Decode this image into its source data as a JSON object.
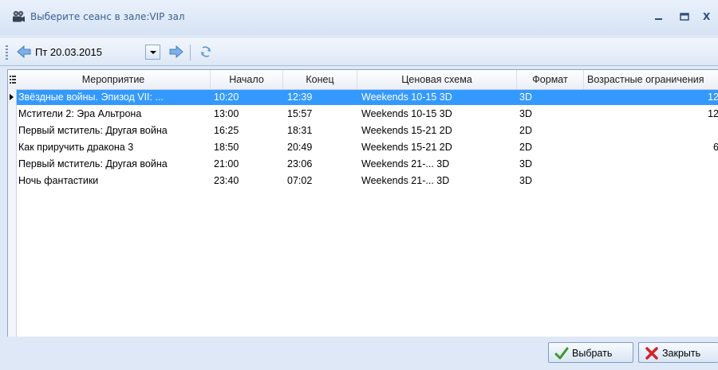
{
  "window": {
    "title": "Выберите сеанс в зале:VIP зал",
    "min_glyph": "_",
    "max_glyph": "▭",
    "close_glyph": "X"
  },
  "toolbar": {
    "date_value": "Пт 20.03.2015"
  },
  "grid": {
    "columns": [
      {
        "key": "event",
        "label": "Мероприятие"
      },
      {
        "key": "start",
        "label": "Начало"
      },
      {
        "key": "end",
        "label": "Конец"
      },
      {
        "key": "price",
        "label": "Ценовая схема"
      },
      {
        "key": "format",
        "label": "Формат"
      },
      {
        "key": "age",
        "label": "Возрастные ограничения"
      }
    ],
    "rows": [
      {
        "event": "Звёздные войны. Эпизод VII: ...",
        "start": "10:20",
        "end": "12:39",
        "price": "Weekends 10-15 3D",
        "format": "3D",
        "age": "12"
      },
      {
        "event": "Мстители 2: Эра Альтрона",
        "start": "13:00",
        "end": "15:57",
        "price": "Weekends 10-15 3D",
        "format": "3D",
        "age": "12"
      },
      {
        "event": "Первый мститель: Другая война",
        "start": "16:25",
        "end": "18:31",
        "price": "Weekends 15-21 2D",
        "format": "2D",
        "age": ""
      },
      {
        "event": "Как приручить дракона 3",
        "start": "18:50",
        "end": "20:49",
        "price": "Weekends 15-21 2D",
        "format": "2D",
        "age": "6"
      },
      {
        "event": "Первый мститель: Другая война",
        "start": "21:00",
        "end": "23:06",
        "price": "Weekends 21-... 3D",
        "format": "3D",
        "age": ""
      },
      {
        "event": "Ночь фантастики",
        "start": "23:40",
        "end": "07:02",
        "price": "Weekends 21-... 3D",
        "format": "3D",
        "age": ""
      }
    ],
    "selected_row": 0
  },
  "footer": {
    "select_label": "Выбрать",
    "close_label": "Закрыть"
  },
  "colors": {
    "selection": "#3399ff",
    "window_bg": "#dfe8f6",
    "title_text": "#3b5f8f"
  },
  "icons": {
    "title": "camera-reel-icon",
    "prev": "arrow-left-icon",
    "next": "arrow-right-icon",
    "refresh": "refresh-icon",
    "select": "checkmark-icon",
    "close": "red-x-icon"
  }
}
